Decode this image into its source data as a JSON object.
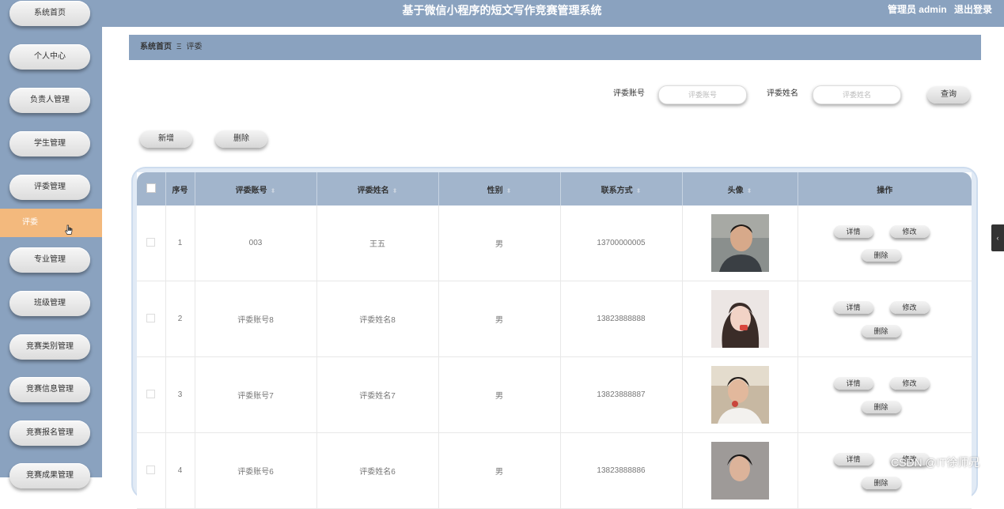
{
  "header": {
    "title": "基于微信小程序的短文写作竞赛管理系统",
    "user_label": "管理员 admin",
    "logout": "退出登录"
  },
  "sidebar": {
    "items": [
      {
        "label": "系统首页"
      },
      {
        "label": "个人中心"
      },
      {
        "label": "负责人管理"
      },
      {
        "label": "学生管理"
      },
      {
        "label": "评委管理"
      },
      {
        "label": "专业管理"
      },
      {
        "label": "班级管理"
      },
      {
        "label": "竞赛类别管理"
      },
      {
        "label": "竞赛信息管理"
      },
      {
        "label": "竞赛报名管理"
      },
      {
        "label": "竞赛成果管理"
      }
    ],
    "active_sub": "评委"
  },
  "breadcrumb": {
    "home": "系统首页",
    "separator": "Ξ",
    "current": "评委"
  },
  "search": {
    "account_label": "评委账号",
    "account_placeholder": "评委账号",
    "name_label": "评委姓名",
    "name_placeholder": "评委姓名",
    "query_button": "查询"
  },
  "actions": {
    "add": "新增",
    "delete": "删除"
  },
  "table": {
    "columns": [
      "序号",
      "评委账号",
      "评委姓名",
      "性别",
      "联系方式",
      "头像",
      "操作"
    ],
    "rows": [
      {
        "index": "1",
        "account": "003",
        "name": "王五",
        "gender": "男",
        "phone": "13700000005"
      },
      {
        "index": "2",
        "account": "评委账号8",
        "name": "评委姓名8",
        "gender": "男",
        "phone": "13823888888"
      },
      {
        "index": "3",
        "account": "评委账号7",
        "name": "评委姓名7",
        "gender": "男",
        "phone": "13823888887"
      },
      {
        "index": "4",
        "account": "评委账号6",
        "name": "评委姓名6",
        "gender": "男",
        "phone": "13823888886"
      }
    ],
    "ops": {
      "detail": "详情",
      "edit": "修改",
      "delete": "删除"
    }
  },
  "watermark": "CSDN @IT徐师兄",
  "colors": {
    "header_bg": "#8aa2bf",
    "active_item": "#f3b97d",
    "table_header": "#a2b5cc"
  }
}
